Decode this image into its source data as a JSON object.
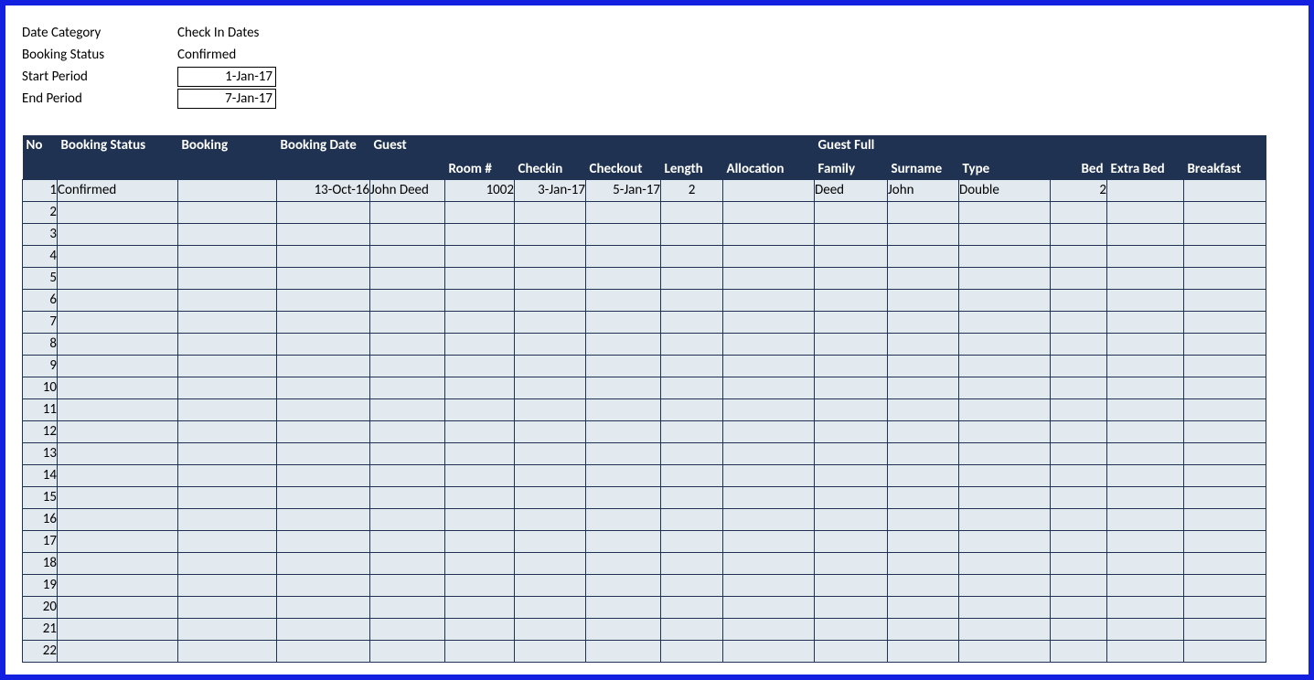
{
  "filters": {
    "rows": [
      {
        "label": "Date Category",
        "value": "Check In Dates",
        "boxed": false
      },
      {
        "label": "Booking Status",
        "value": "Confirmed",
        "boxed": false
      },
      {
        "label": "Start Period",
        "value": "1-Jan-17",
        "boxed": true
      },
      {
        "label": "End Period",
        "value": "7-Jan-17",
        "boxed": true
      }
    ]
  },
  "headers": {
    "row1": {
      "no": "No",
      "status": "Booking Status",
      "booking": "Booking",
      "bdate": "Booking Date",
      "guest": "Guest",
      "guest_full": "Guest Full"
    },
    "row2": {
      "room": "Room #",
      "checkin": "Checkin",
      "checkout": "Checkout",
      "length": "Length",
      "allocation": "Allocation",
      "family": "Family",
      "surname": "Surname",
      "type": "Type",
      "bed": "Bed",
      "extra_bed": "Extra Bed",
      "breakfast": "Breakfast"
    }
  },
  "rows": [
    {
      "no": "1",
      "status": "Confirmed",
      "booking": "",
      "bdate": "13-Oct-16",
      "guest": "John Deed",
      "room": "1002",
      "checkin": "3-Jan-17",
      "checkout": "5-Jan-17",
      "length": "2",
      "allocation": "",
      "family": "Deed",
      "surname": "John",
      "type": "Double",
      "bed": "2",
      "extra_bed": "",
      "breakfast": ""
    },
    {
      "no": "2"
    },
    {
      "no": "3"
    },
    {
      "no": "4"
    },
    {
      "no": "5"
    },
    {
      "no": "6"
    },
    {
      "no": "7"
    },
    {
      "no": "8"
    },
    {
      "no": "9"
    },
    {
      "no": "10"
    },
    {
      "no": "11"
    },
    {
      "no": "12"
    },
    {
      "no": "13"
    },
    {
      "no": "14"
    },
    {
      "no": "15"
    },
    {
      "no": "16"
    },
    {
      "no": "17"
    },
    {
      "no": "18"
    },
    {
      "no": "19"
    },
    {
      "no": "20"
    },
    {
      "no": "21"
    },
    {
      "no": "22"
    }
  ]
}
